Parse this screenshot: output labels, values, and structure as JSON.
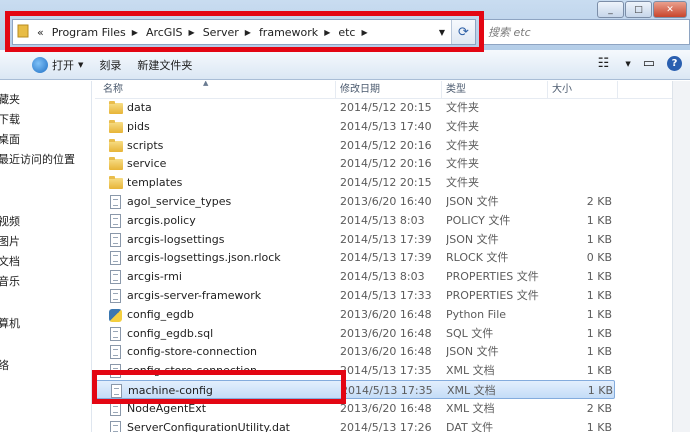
{
  "window": {
    "controls": {
      "minimize": "_",
      "maximize": "□",
      "close": "✕"
    }
  },
  "address": {
    "segments": [
      "«",
      "Program Files",
      "ArcGIS",
      "Server",
      "framework",
      "etc"
    ],
    "refresh_icon": "refresh-icon"
  },
  "search": {
    "placeholder": "搜索 etc"
  },
  "toolbar": {
    "open_label": "打开",
    "burn_label": "刻录",
    "new_folder_label": "新建文件夹"
  },
  "nav": {
    "items": [
      "藏夹",
      "下载",
      "桌面",
      "最近访问的位置",
      "视频",
      "图片",
      "文档",
      "音乐",
      "算机",
      "络"
    ]
  },
  "columns": {
    "name": "名称",
    "date": "修改日期",
    "type": "类型",
    "size": "大小"
  },
  "files": [
    {
      "name": "data",
      "date": "2014/5/12 20:15",
      "type": "文件夹",
      "size": "",
      "icon": "folder-icon"
    },
    {
      "name": "pids",
      "date": "2014/5/13 17:40",
      "type": "文件夹",
      "size": "",
      "icon": "folder-icon"
    },
    {
      "name": "scripts",
      "date": "2014/5/12 20:16",
      "type": "文件夹",
      "size": "",
      "icon": "folder-icon"
    },
    {
      "name": "service",
      "date": "2014/5/12 20:16",
      "type": "文件夹",
      "size": "",
      "icon": "folder-icon"
    },
    {
      "name": "templates",
      "date": "2014/5/12 20:15",
      "type": "文件夹",
      "size": "",
      "icon": "folder-icon"
    },
    {
      "name": "agol_service_types",
      "date": "2013/6/20 16:40",
      "type": "JSON 文件",
      "size": "2 KB",
      "icon": "file-icon"
    },
    {
      "name": "arcgis.policy",
      "date": "2014/5/13 8:03",
      "type": "POLICY 文件",
      "size": "1 KB",
      "icon": "file-icon"
    },
    {
      "name": "arcgis-logsettings",
      "date": "2014/5/13 17:39",
      "type": "JSON 文件",
      "size": "1 KB",
      "icon": "file-icon"
    },
    {
      "name": "arcgis-logsettings.json.rlock",
      "date": "2014/5/13 17:39",
      "type": "RLOCK 文件",
      "size": "0 KB",
      "icon": "file-icon"
    },
    {
      "name": "arcgis-rmi",
      "date": "2014/5/13 8:03",
      "type": "PROPERTIES 文件",
      "size": "1 KB",
      "icon": "file-icon"
    },
    {
      "name": "arcgis-server-framework",
      "date": "2014/5/13 17:33",
      "type": "PROPERTIES 文件",
      "size": "1 KB",
      "icon": "file-icon"
    },
    {
      "name": "config_egdb",
      "date": "2013/6/20 16:48",
      "type": "Python File",
      "size": "1 KB",
      "icon": "python-file-icon"
    },
    {
      "name": "config_egdb.sql",
      "date": "2013/6/20 16:48",
      "type": "SQL 文件",
      "size": "1 KB",
      "icon": "file-icon"
    },
    {
      "name": "config-store-connection",
      "date": "2013/6/20 16:48",
      "type": "JSON 文件",
      "size": "1 KB",
      "icon": "file-icon"
    },
    {
      "name": "config-store-connection",
      "date": "2014/5/13 17:35",
      "type": "XML 文档",
      "size": "1 KB",
      "icon": "file-icon"
    },
    {
      "name": "machine-config",
      "date": "2014/5/13 17:35",
      "type": "XML 文档",
      "size": "1 KB",
      "icon": "file-icon",
      "selected": true
    },
    {
      "name": "NodeAgentExt",
      "date": "2013/6/20 16:48",
      "type": "XML 文档",
      "size": "2 KB",
      "icon": "file-icon"
    },
    {
      "name": "ServerConfigurationUtility.dat",
      "date": "2014/5/13 17:26",
      "type": "DAT 文件",
      "size": "1 KB",
      "icon": "file-icon"
    }
  ],
  "colors": {
    "highlight_box": "#e30613",
    "selection": "#c4dcf7"
  }
}
